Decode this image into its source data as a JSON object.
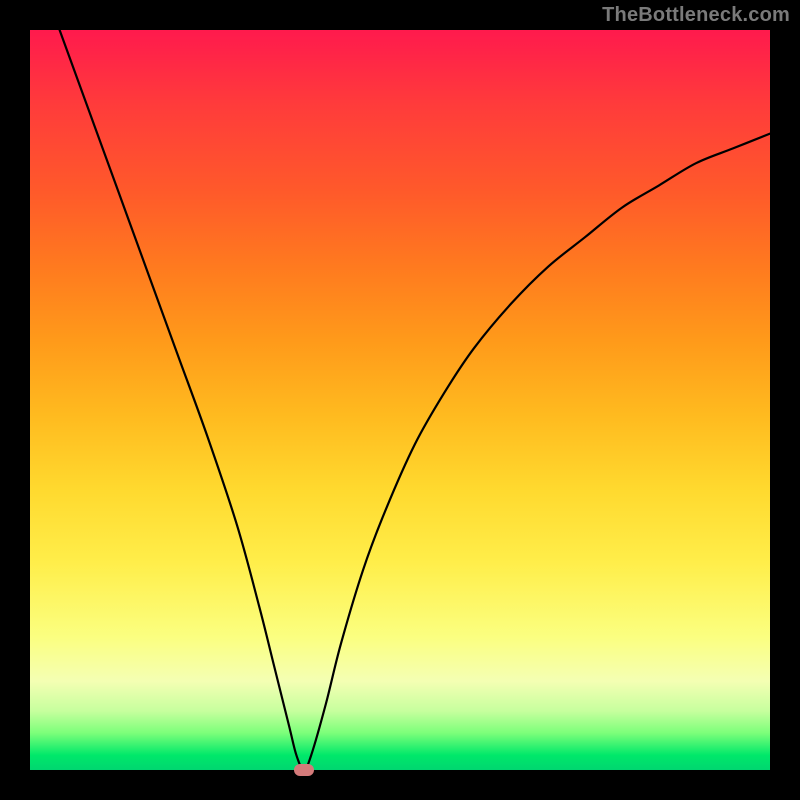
{
  "attribution": "TheBottleneck.com",
  "chart_data": {
    "type": "line",
    "title": "",
    "xlabel": "",
    "ylabel": "",
    "xlim": [
      0,
      100
    ],
    "ylim": [
      0,
      100
    ],
    "gradient_stops": [
      {
        "pct": 0,
        "color": "#ff1a4d"
      },
      {
        "pct": 10,
        "color": "#ff3b3b"
      },
      {
        "pct": 22,
        "color": "#ff5a2a"
      },
      {
        "pct": 32,
        "color": "#ff7a1f"
      },
      {
        "pct": 42,
        "color": "#ff9a1a"
      },
      {
        "pct": 52,
        "color": "#ffba1f"
      },
      {
        "pct": 62,
        "color": "#ffd92e"
      },
      {
        "pct": 72,
        "color": "#ffee4a"
      },
      {
        "pct": 82,
        "color": "#fbff80"
      },
      {
        "pct": 88,
        "color": "#f4ffb3"
      },
      {
        "pct": 92,
        "color": "#c7ff9e"
      },
      {
        "pct": 95,
        "color": "#7cff7a"
      },
      {
        "pct": 98,
        "color": "#00e86a"
      },
      {
        "pct": 100,
        "color": "#00d670"
      }
    ],
    "series": [
      {
        "name": "bottleneck-curve",
        "x": [
          4,
          8,
          12,
          16,
          20,
          24,
          28,
          31,
          33,
          35,
          36,
          37,
          38,
          40,
          42,
          45,
          48,
          52,
          56,
          60,
          65,
          70,
          75,
          80,
          85,
          90,
          95,
          100
        ],
        "y": [
          100,
          89,
          78,
          67,
          56,
          45,
          33,
          22,
          14,
          6,
          2,
          0,
          2,
          9,
          17,
          27,
          35,
          44,
          51,
          57,
          63,
          68,
          72,
          76,
          79,
          82,
          84,
          86
        ]
      }
    ],
    "marker": {
      "x": 37,
      "y": 0,
      "color": "#d47a7a"
    }
  }
}
